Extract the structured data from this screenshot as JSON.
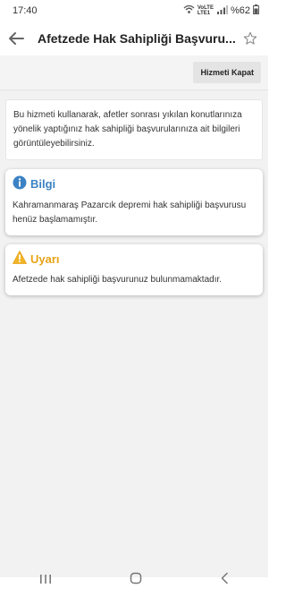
{
  "status_bar": {
    "time": "17:40",
    "network_top": "VoLTE",
    "network_bottom": "LTE1",
    "battery": "%62",
    "icons": [
      "wifi-icon",
      "signal-icon",
      "battery-icon"
    ]
  },
  "app_bar": {
    "title": "Afetzede Hak Sahipliği Başvuru...",
    "icons": [
      "back-arrow-icon",
      "star-icon"
    ]
  },
  "actions": {
    "close_service": "Hizmeti Kapat"
  },
  "description": "Bu hizmeti kullanarak, afetler sonrası yıkılan konutlarınıza yönelik yaptığınız hak sahipliği başvurularınıza ait bilgileri görüntüleyebilirsiniz.",
  "info_card": {
    "title": "Bilgi",
    "text": "Kahramanmaraş Pazarcık depremi hak sahipliği başvurusu henüz başlamamıştır.",
    "icon": "info-icon",
    "color": "#3b82c4"
  },
  "warning_card": {
    "title": "Uyarı",
    "text": "Afetzede hak sahipliği başvurunuz bulunmamaktadır.",
    "icon": "warning-icon",
    "color": "#e8a317"
  },
  "nav_bar": {
    "icons": [
      "recent-apps-icon",
      "home-icon",
      "back-icon"
    ]
  }
}
